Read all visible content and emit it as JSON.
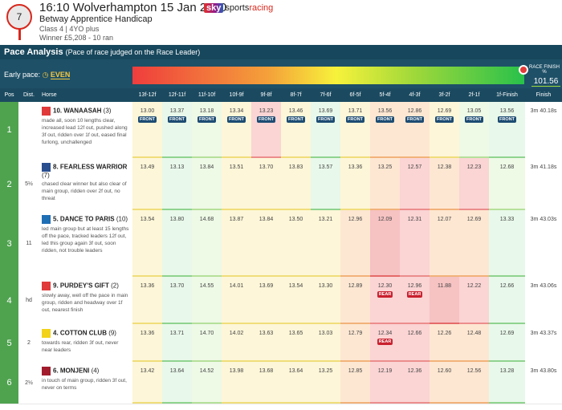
{
  "race": {
    "number": "7",
    "title": "16:10 Wolverhampton 15 Jan 2020",
    "logo_sky": "sky",
    "logo_sports": "sports",
    "logo_racing": "racing",
    "name": "Betway Apprentice Handicap",
    "class": "Class 4 | 4YO plus",
    "winner": "Winner £5,208 - 10 ran"
  },
  "pace": {
    "title": "Pace Analysis",
    "subtitle": "(Pace of race judged on the Race Leader)",
    "early_label": "Early pace:",
    "early_value": "EVEN",
    "race_finish_label": "RACE FINISH %",
    "race_finish_value": "101.56"
  },
  "columns": [
    "Pos",
    "Dist.",
    "Horse",
    "13f-12f",
    "12f-11f",
    "11f-10f",
    "10f-9f",
    "9f-8f",
    "8f-7f",
    "7f-6f",
    "6f-5f",
    "5f-4f",
    "4f-3f",
    "3f-2f",
    "2f-1f",
    "1f-Finish",
    "Finish"
  ],
  "rows": [
    {
      "pos": "1",
      "dist": "",
      "horse": "10. WANAASAH",
      "draw": "(3)",
      "silk_color": "#e03a3a",
      "comment": "made all, soon 10 lengths clear, increased lead 12f out, pushed along 3f out, ridden over 1f out, eased final furlong, unchallenged",
      "sectionals": [
        {
          "v": "13.00",
          "t": "FRONT",
          "c": "c-yellow"
        },
        {
          "v": "13.37",
          "t": "FRONT",
          "c": "c-green"
        },
        {
          "v": "13.18",
          "t": "FRONT",
          "c": "c-lgreen"
        },
        {
          "v": "13.34",
          "t": "FRONT",
          "c": "c-yellow"
        },
        {
          "v": "13.23",
          "t": "FRONT",
          "c": "c-red"
        },
        {
          "v": "13.46",
          "t": "FRONT",
          "c": "c-yellow"
        },
        {
          "v": "13.69",
          "t": "FRONT",
          "c": "c-green"
        },
        {
          "v": "13.71",
          "t": "FRONT",
          "c": "c-yellow"
        },
        {
          "v": "13.56",
          "t": "FRONT",
          "c": "c-orange"
        },
        {
          "v": "12.86",
          "t": "FRONT",
          "c": "c-orange"
        },
        {
          "v": "12.69",
          "t": "FRONT",
          "c": "c-yellow"
        },
        {
          "v": "13.05",
          "t": "FRONT",
          "c": "c-lgreen"
        },
        {
          "v": "13.56",
          "t": "FRONT",
          "c": "c-green"
        }
      ],
      "finish": "3m 40.18s"
    },
    {
      "pos": "2",
      "dist": "5½",
      "horse": "8. FEARLESS WARRIOR",
      "draw": "(7)",
      "silk_color": "#2a4f8f",
      "comment": "chased clear winner but also clear of main group, ridden over 2f out, no threat",
      "sectionals": [
        {
          "v": "13.49",
          "t": "",
          "c": "c-yellow"
        },
        {
          "v": "13.13",
          "t": "",
          "c": "c-green"
        },
        {
          "v": "13.84",
          "t": "",
          "c": "c-lgreen"
        },
        {
          "v": "13.51",
          "t": "",
          "c": "c-yellow"
        },
        {
          "v": "13.70",
          "t": "",
          "c": "c-yellow"
        },
        {
          "v": "13.83",
          "t": "",
          "c": "c-yellow"
        },
        {
          "v": "13.57",
          "t": "",
          "c": "c-green"
        },
        {
          "v": "13.36",
          "t": "",
          "c": "c-yellow"
        },
        {
          "v": "13.25",
          "t": "",
          "c": "c-orange"
        },
        {
          "v": "12.57",
          "t": "",
          "c": "c-red"
        },
        {
          "v": "12.38",
          "t": "",
          "c": "c-orange"
        },
        {
          "v": "12.23",
          "t": "",
          "c": "c-red"
        },
        {
          "v": "12.68",
          "t": "",
          "c": "c-lgreen"
        }
      ],
      "finish": "3m 41.18s"
    },
    {
      "pos": "3",
      "dist": "11",
      "horse": "5. DANCE TO PARIS",
      "draw": "(10)",
      "silk_color": "#1f6fb5",
      "comment": "led main group but at least 15 lengths off the pace, tracked leaders 12f out, led this group again 3f out, soon ridden, not trouble leaders",
      "sectionals": [
        {
          "v": "13.54",
          "t": "",
          "c": "c-yellow"
        },
        {
          "v": "13.80",
          "t": "",
          "c": "c-green"
        },
        {
          "v": "14.68",
          "t": "",
          "c": "c-lgreen"
        },
        {
          "v": "13.87",
          "t": "",
          "c": "c-yellow"
        },
        {
          "v": "13.84",
          "t": "",
          "c": "c-yellow"
        },
        {
          "v": "13.50",
          "t": "",
          "c": "c-yellow"
        },
        {
          "v": "13.21",
          "t": "",
          "c": "c-yellow"
        },
        {
          "v": "12.96",
          "t": "",
          "c": "c-orange"
        },
        {
          "v": "12.09",
          "t": "",
          "c": "c-dred"
        },
        {
          "v": "12.31",
          "t": "",
          "c": "c-red"
        },
        {
          "v": "12.07",
          "t": "",
          "c": "c-orange"
        },
        {
          "v": "12.69",
          "t": "",
          "c": "c-orange"
        },
        {
          "v": "13.33",
          "t": "",
          "c": "c-green"
        }
      ],
      "finish": "3m 43.03s"
    },
    {
      "pos": "4",
      "dist": "hd",
      "horse": "9. PURDEY'S GIFT",
      "draw": "(2)",
      "silk_color": "#e03a3a",
      "comment": "slowly away, well off the pace in main group, ridden and headway over 1f out, nearest finish",
      "sectionals": [
        {
          "v": "13.36",
          "t": "",
          "c": "c-yellow"
        },
        {
          "v": "13.70",
          "t": "",
          "c": "c-green"
        },
        {
          "v": "14.55",
          "t": "",
          "c": "c-lgreen"
        },
        {
          "v": "14.01",
          "t": "",
          "c": "c-yellow"
        },
        {
          "v": "13.69",
          "t": "",
          "c": "c-yellow"
        },
        {
          "v": "13.54",
          "t": "",
          "c": "c-yellow"
        },
        {
          "v": "13.30",
          "t": "",
          "c": "c-yellow"
        },
        {
          "v": "12.89",
          "t": "",
          "c": "c-orange"
        },
        {
          "v": "12.30",
          "t": "REAR",
          "c": "c-red"
        },
        {
          "v": "12.96",
          "t": "REAR",
          "c": "c-red"
        },
        {
          "v": "11.88",
          "t": "",
          "c": "c-dred"
        },
        {
          "v": "12.22",
          "t": "",
          "c": "c-red"
        },
        {
          "v": "12.66",
          "t": "",
          "c": "c-green"
        }
      ],
      "finish": "3m 43.06s"
    },
    {
      "pos": "5",
      "dist": "2",
      "horse": "4. COTTON CLUB",
      "draw": "(9)",
      "silk_color": "#f2d21a",
      "comment": "towards rear, ridden 3f out, never near leaders",
      "sectionals": [
        {
          "v": "13.36",
          "t": "",
          "c": "c-yellow"
        },
        {
          "v": "13.71",
          "t": "",
          "c": "c-green"
        },
        {
          "v": "14.70",
          "t": "",
          "c": "c-lgreen"
        },
        {
          "v": "14.02",
          "t": "",
          "c": "c-yellow"
        },
        {
          "v": "13.63",
          "t": "",
          "c": "c-yellow"
        },
        {
          "v": "13.65",
          "t": "",
          "c": "c-yellow"
        },
        {
          "v": "13.03",
          "t": "",
          "c": "c-yellow"
        },
        {
          "v": "12.79",
          "t": "",
          "c": "c-orange"
        },
        {
          "v": "12.34",
          "t": "REAR",
          "c": "c-red"
        },
        {
          "v": "12.66",
          "t": "",
          "c": "c-red"
        },
        {
          "v": "12.26",
          "t": "",
          "c": "c-orange"
        },
        {
          "v": "12.48",
          "t": "",
          "c": "c-orange"
        },
        {
          "v": "12.69",
          "t": "",
          "c": "c-green"
        }
      ],
      "finish": "3m 43.37s"
    },
    {
      "pos": "6",
      "dist": "2½",
      "horse": "6. MONJENI",
      "draw": "(4)",
      "silk_color": "#a11d2d",
      "comment": "in touch of main group, ridden 3f out, never on terms",
      "sectionals": [
        {
          "v": "13.42",
          "t": "",
          "c": "c-yellow"
        },
        {
          "v": "13.64",
          "t": "",
          "c": "c-green"
        },
        {
          "v": "14.52",
          "t": "",
          "c": "c-lgreen"
        },
        {
          "v": "13.98",
          "t": "",
          "c": "c-yellow"
        },
        {
          "v": "13.68",
          "t": "",
          "c": "c-yellow"
        },
        {
          "v": "13.64",
          "t": "",
          "c": "c-yellow"
        },
        {
          "v": "13.25",
          "t": "",
          "c": "c-yellow"
        },
        {
          "v": "12.85",
          "t": "",
          "c": "c-orange"
        },
        {
          "v": "12.19",
          "t": "",
          "c": "c-red"
        },
        {
          "v": "12.36",
          "t": "",
          "c": "c-red"
        },
        {
          "v": "12.60",
          "t": "",
          "c": "c-orange"
        },
        {
          "v": "12.56",
          "t": "",
          "c": "c-orange"
        },
        {
          "v": "13.28",
          "t": "",
          "c": "c-green"
        }
      ],
      "finish": "3m 43.80s"
    }
  ]
}
